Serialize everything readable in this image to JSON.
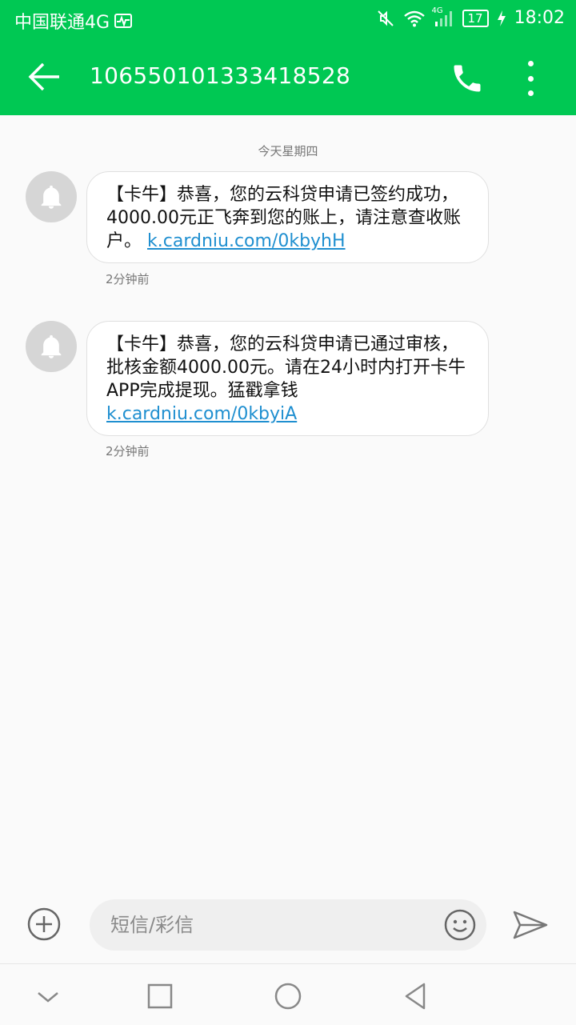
{
  "status_bar": {
    "carrier": "中国联通4G",
    "network": "4G",
    "battery": "17",
    "time": "18:02"
  },
  "app_bar": {
    "title": "1065501013334185 28"
  },
  "conversation": {
    "date_separator": "今天星期四",
    "messages": [
      {
        "text": "【卡牛】恭喜，您的云科贷申请已签约成功，4000.00元正飞奔到您的账上，请注意查收账户。",
        "link": "k.cardniu.com/0kbyhH",
        "time": "2分钟前"
      },
      {
        "text": "【卡牛】恭喜，您的云科贷申请已通过审核，批核金额4000.00元。请在24小时内打开卡牛APP完成提现。猛戳拿钱",
        "link": "k.cardniu.com/0kbyiA",
        "time": "2分钟前"
      }
    ]
  },
  "compose": {
    "placeholder": "短信/彩信"
  },
  "colors": {
    "brand": "#00c853",
    "link": "#1f8fd0"
  }
}
